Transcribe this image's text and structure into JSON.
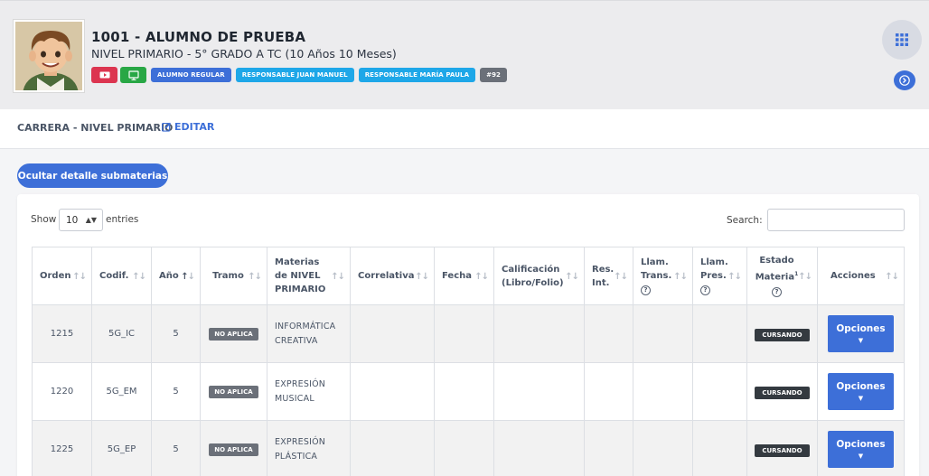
{
  "student": {
    "name": "1001 - ALUMNO DE PRUEBA",
    "level": "NIVEL PRIMARIO - 5° GRADO A TC (10 Años 10 Meses)",
    "badges": [
      {
        "label": "ALUMNO REGULAR",
        "color": "#3d6fd8"
      },
      {
        "label": "RESPONSABLE JUAN MANUEL",
        "color": "#1ea7e8"
      },
      {
        "label": "RESPONSABLE MARÍA PAULA",
        "color": "#1ea7e8"
      },
      {
        "label": "#92",
        "color": "#6b7079"
      }
    ],
    "icon_badges": [
      {
        "icon": "video-icon",
        "color": "#dc3550"
      },
      {
        "icon": "monitor-icon",
        "color": "#28a745"
      }
    ]
  },
  "section": {
    "title": "CARRERA - NIVEL PRIMARIO",
    "edit_label": "EDITAR"
  },
  "toggle_button": "Ocultar detalle submaterias",
  "datatable": {
    "show_label": "Show",
    "length_value": "10",
    "entries_label": "entries",
    "search_label": "Search:"
  },
  "columns": [
    "Orden",
    "Codif.",
    "Año",
    "Tramo",
    "Materias de NIVEL PRIMARIO",
    "Correlativa",
    "Fecha",
    "Calificación (Libro/Folio)",
    "Res. Int.",
    "Llam. Trans.",
    "Llam. Pres.",
    "Estado Materia",
    "Acciones"
  ],
  "estado_superscript": "1",
  "rows": [
    {
      "orden": "1215",
      "codif": "5G_IC",
      "anio": "5",
      "tramo": "NO APLICA",
      "materia": "INFORMÁTICA CREATIVA",
      "estado": "CURSANDO",
      "accion": "Opciones"
    },
    {
      "orden": "1220",
      "codif": "5G_EM",
      "anio": "5",
      "tramo": "NO APLICA",
      "materia": "EXPRESIÓN MUSICAL",
      "estado": "CURSANDO",
      "accion": "Opciones"
    },
    {
      "orden": "1225",
      "codif": "5G_EP",
      "anio": "5",
      "tramo": "NO APLICA",
      "materia": "EXPRESIÓN PLÁSTICA",
      "estado": "CURSANDO",
      "accion": "Opciones"
    }
  ],
  "colors": {
    "primary": "#3d6fd8",
    "danger": "#dc3550",
    "success": "#28a745",
    "info": "#1ea7e8",
    "dark": "#343a40"
  }
}
